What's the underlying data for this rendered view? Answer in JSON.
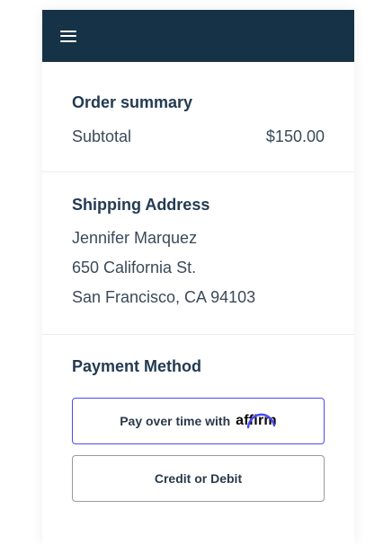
{
  "colors": {
    "topbar": "#163247",
    "affirm_accent": "#4a4af4",
    "heading": "#233b52"
  },
  "topbar": {
    "menu_icon": "hamburger-menu-icon"
  },
  "order_summary": {
    "title": "Order summary",
    "subtotal_label": "Subtotal",
    "subtotal_value": "$150.00"
  },
  "shipping_address": {
    "title": "Shipping Address",
    "name": "Jennifer Marquez",
    "street": "650 California St.",
    "city_line": "San Francisco, CA 94103"
  },
  "payment_method": {
    "title": "Payment Method",
    "affirm_button_label": "Pay over time with",
    "affirm_logo_text": "affirm",
    "credit_button_label": "Credit or Debit"
  }
}
